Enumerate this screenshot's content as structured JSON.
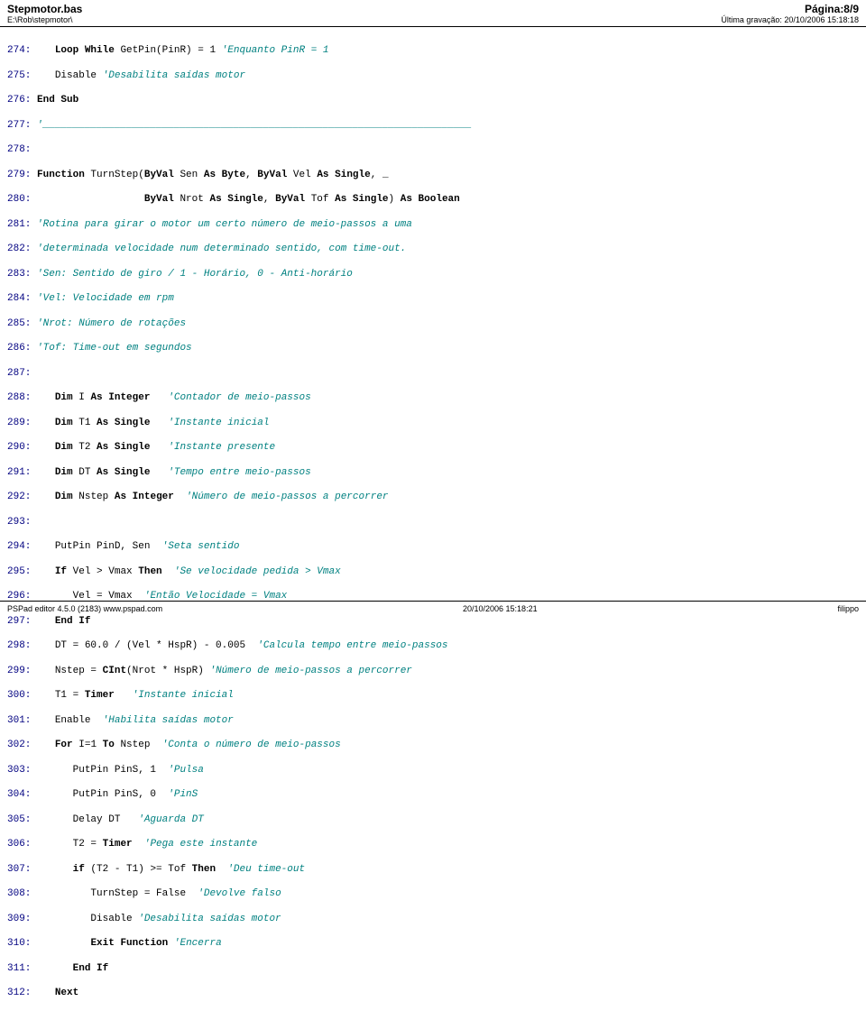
{
  "header": {
    "title": "Stepmotor.bas",
    "path": "E:\\Rob\\stepmotor\\",
    "page": "Página:8/9",
    "saved": "Última gravação: 20/10/2006 15:18:18"
  },
  "footer": {
    "left": "PSPad editor 4.5.0 (2183) www.pspad.com",
    "center": "20/10/2006 15:18:21",
    "right": "filippo"
  },
  "lines": [
    {
      "n": "274:",
      "segs": [
        {
          "t": "   "
        },
        {
          "t": "Loop While",
          "c": "kw"
        },
        {
          "t": " GetPin(PinR) = 1 "
        },
        {
          "t": "'Enquanto PinR = 1",
          "c": "cm"
        }
      ]
    },
    {
      "n": "275:",
      "segs": [
        {
          "t": "   Disable "
        },
        {
          "t": "'Desabilita saídas motor",
          "c": "cm"
        }
      ]
    },
    {
      "n": "276:",
      "segs": [
        {
          "t": "End Sub",
          "c": "kw"
        }
      ]
    },
    {
      "n": "277:",
      "segs": [
        {
          "t": "'________________________________________________________________________",
          "c": "cm"
        }
      ]
    },
    {
      "n": "278:",
      "segs": []
    },
    {
      "n": "279:",
      "segs": [
        {
          "t": "Function",
          "c": "kw"
        },
        {
          "t": " TurnStep("
        },
        {
          "t": "ByVal",
          "c": "kw"
        },
        {
          "t": " Sen "
        },
        {
          "t": "As Byte",
          "c": "kw"
        },
        {
          "t": ", "
        },
        {
          "t": "ByVal",
          "c": "kw"
        },
        {
          "t": " Vel "
        },
        {
          "t": "As Single",
          "c": "kw"
        },
        {
          "t": ", _"
        }
      ]
    },
    {
      "n": "280:",
      "segs": [
        {
          "t": "                  "
        },
        {
          "t": "ByVal",
          "c": "kw"
        },
        {
          "t": " Nrot "
        },
        {
          "t": "As Single",
          "c": "kw"
        },
        {
          "t": ", "
        },
        {
          "t": "ByVal",
          "c": "kw"
        },
        {
          "t": " Tof "
        },
        {
          "t": "As Single",
          "c": "kw"
        },
        {
          "t": ") "
        },
        {
          "t": "As Boolean",
          "c": "kw"
        }
      ]
    },
    {
      "n": "281:",
      "segs": [
        {
          "t": "'Rotina para girar o motor um certo número de meio-passos a uma",
          "c": "cm"
        }
      ]
    },
    {
      "n": "282:",
      "segs": [
        {
          "t": "'determinada velocidade num determinado sentido, com time-out.",
          "c": "cm"
        }
      ]
    },
    {
      "n": "283:",
      "segs": [
        {
          "t": "'Sen: Sentido de giro / 1 - Horário, 0 - Anti-horário",
          "c": "cm"
        }
      ]
    },
    {
      "n": "284:",
      "segs": [
        {
          "t": "'Vel: Velocidade em rpm",
          "c": "cm"
        }
      ]
    },
    {
      "n": "285:",
      "segs": [
        {
          "t": "'Nrot: Número de rotações",
          "c": "cm"
        }
      ]
    },
    {
      "n": "286:",
      "segs": [
        {
          "t": "'Tof: Time-out em segundos",
          "c": "cm"
        }
      ]
    },
    {
      "n": "287:",
      "segs": []
    },
    {
      "n": "288:",
      "segs": [
        {
          "t": "   "
        },
        {
          "t": "Dim",
          "c": "kw"
        },
        {
          "t": " I "
        },
        {
          "t": "As Integer",
          "c": "kw"
        },
        {
          "t": "   "
        },
        {
          "t": "'Contador de meio-passos",
          "c": "cm"
        }
      ]
    },
    {
      "n": "289:",
      "segs": [
        {
          "t": "   "
        },
        {
          "t": "Dim",
          "c": "kw"
        },
        {
          "t": " T1 "
        },
        {
          "t": "As Single",
          "c": "kw"
        },
        {
          "t": "   "
        },
        {
          "t": "'Instante inicial",
          "c": "cm"
        }
      ]
    },
    {
      "n": "290:",
      "segs": [
        {
          "t": "   "
        },
        {
          "t": "Dim",
          "c": "kw"
        },
        {
          "t": " T2 "
        },
        {
          "t": "As Single",
          "c": "kw"
        },
        {
          "t": "   "
        },
        {
          "t": "'Instante presente",
          "c": "cm"
        }
      ]
    },
    {
      "n": "291:",
      "segs": [
        {
          "t": "   "
        },
        {
          "t": "Dim",
          "c": "kw"
        },
        {
          "t": " DT "
        },
        {
          "t": "As Single",
          "c": "kw"
        },
        {
          "t": "   "
        },
        {
          "t": "'Tempo entre meio-passos",
          "c": "cm"
        }
      ]
    },
    {
      "n": "292:",
      "segs": [
        {
          "t": "   "
        },
        {
          "t": "Dim",
          "c": "kw"
        },
        {
          "t": " Nstep "
        },
        {
          "t": "As Integer",
          "c": "kw"
        },
        {
          "t": "  "
        },
        {
          "t": "'Número de meio-passos a percorrer",
          "c": "cm"
        }
      ]
    },
    {
      "n": "293:",
      "segs": []
    },
    {
      "n": "294:",
      "segs": [
        {
          "t": "   PutPin PinD, Sen  "
        },
        {
          "t": "'Seta sentido",
          "c": "cm"
        }
      ]
    },
    {
      "n": "295:",
      "segs": [
        {
          "t": "   "
        },
        {
          "t": "If",
          "c": "kw"
        },
        {
          "t": " Vel > Vmax "
        },
        {
          "t": "Then",
          "c": "kw"
        },
        {
          "t": "  "
        },
        {
          "t": "'Se velocidade pedida > Vmax",
          "c": "cm"
        }
      ]
    },
    {
      "n": "296:",
      "segs": [
        {
          "t": "      Vel = Vmax  "
        },
        {
          "t": "'Então Velocidade = Vmax",
          "c": "cm"
        }
      ]
    },
    {
      "n": "297:",
      "segs": [
        {
          "t": "   "
        },
        {
          "t": "End If",
          "c": "kw"
        }
      ]
    },
    {
      "n": "298:",
      "segs": [
        {
          "t": "   DT = 60.0 / (Vel * HspR) - 0.005  "
        },
        {
          "t": "'Calcula tempo entre meio-passos",
          "c": "cm"
        }
      ]
    },
    {
      "n": "299:",
      "segs": [
        {
          "t": "   Nstep = "
        },
        {
          "t": "CInt",
          "c": "kw"
        },
        {
          "t": "(Nrot * HspR) "
        },
        {
          "t": "'Número de meio-passos a percorrer",
          "c": "cm"
        }
      ]
    },
    {
      "n": "300:",
      "segs": [
        {
          "t": "   T1 = "
        },
        {
          "t": "Timer",
          "c": "kw"
        },
        {
          "t": "   "
        },
        {
          "t": "'Instante inicial",
          "c": "cm"
        }
      ]
    },
    {
      "n": "301:",
      "segs": [
        {
          "t": "   Enable  "
        },
        {
          "t": "'Habilita saídas motor",
          "c": "cm"
        }
      ]
    },
    {
      "n": "302:",
      "segs": [
        {
          "t": "   "
        },
        {
          "t": "For",
          "c": "kw"
        },
        {
          "t": " I=1 "
        },
        {
          "t": "To",
          "c": "kw"
        },
        {
          "t": " Nstep  "
        },
        {
          "t": "'Conta o número de meio-passos",
          "c": "cm"
        }
      ]
    },
    {
      "n": "303:",
      "segs": [
        {
          "t": "      PutPin PinS, 1  "
        },
        {
          "t": "'Pulsa",
          "c": "cm"
        }
      ]
    },
    {
      "n": "304:",
      "segs": [
        {
          "t": "      PutPin PinS, 0  "
        },
        {
          "t": "'PinS",
          "c": "cm"
        }
      ]
    },
    {
      "n": "305:",
      "segs": [
        {
          "t": "      Delay DT   "
        },
        {
          "t": "'Aguarda DT",
          "c": "cm"
        }
      ]
    },
    {
      "n": "306:",
      "segs": [
        {
          "t": "      T2 = "
        },
        {
          "t": "Timer",
          "c": "kw"
        },
        {
          "t": "  "
        },
        {
          "t": "'Pega este instante",
          "c": "cm"
        }
      ]
    },
    {
      "n": "307:",
      "segs": [
        {
          "t": "      "
        },
        {
          "t": "if",
          "c": "kw"
        },
        {
          "t": " (T2 - T1) >= Tof "
        },
        {
          "t": "Then",
          "c": "kw"
        },
        {
          "t": "  "
        },
        {
          "t": "'Deu time-out",
          "c": "cm"
        }
      ]
    },
    {
      "n": "308:",
      "segs": [
        {
          "t": "         TurnStep = False  "
        },
        {
          "t": "'Devolve falso",
          "c": "cm"
        }
      ]
    },
    {
      "n": "309:",
      "segs": [
        {
          "t": "         Disable "
        },
        {
          "t": "'Desabilita saídas motor",
          "c": "cm"
        }
      ]
    },
    {
      "n": "310:",
      "segs": [
        {
          "t": "         "
        },
        {
          "t": "Exit Function",
          "c": "kw"
        },
        {
          "t": " "
        },
        {
          "t": "'Encerra",
          "c": "cm"
        }
      ]
    },
    {
      "n": "311:",
      "segs": [
        {
          "t": "      "
        },
        {
          "t": "End If",
          "c": "kw"
        }
      ]
    },
    {
      "n": "312:",
      "segs": [
        {
          "t": "   "
        },
        {
          "t": "Next",
          "c": "kw"
        }
      ]
    }
  ]
}
